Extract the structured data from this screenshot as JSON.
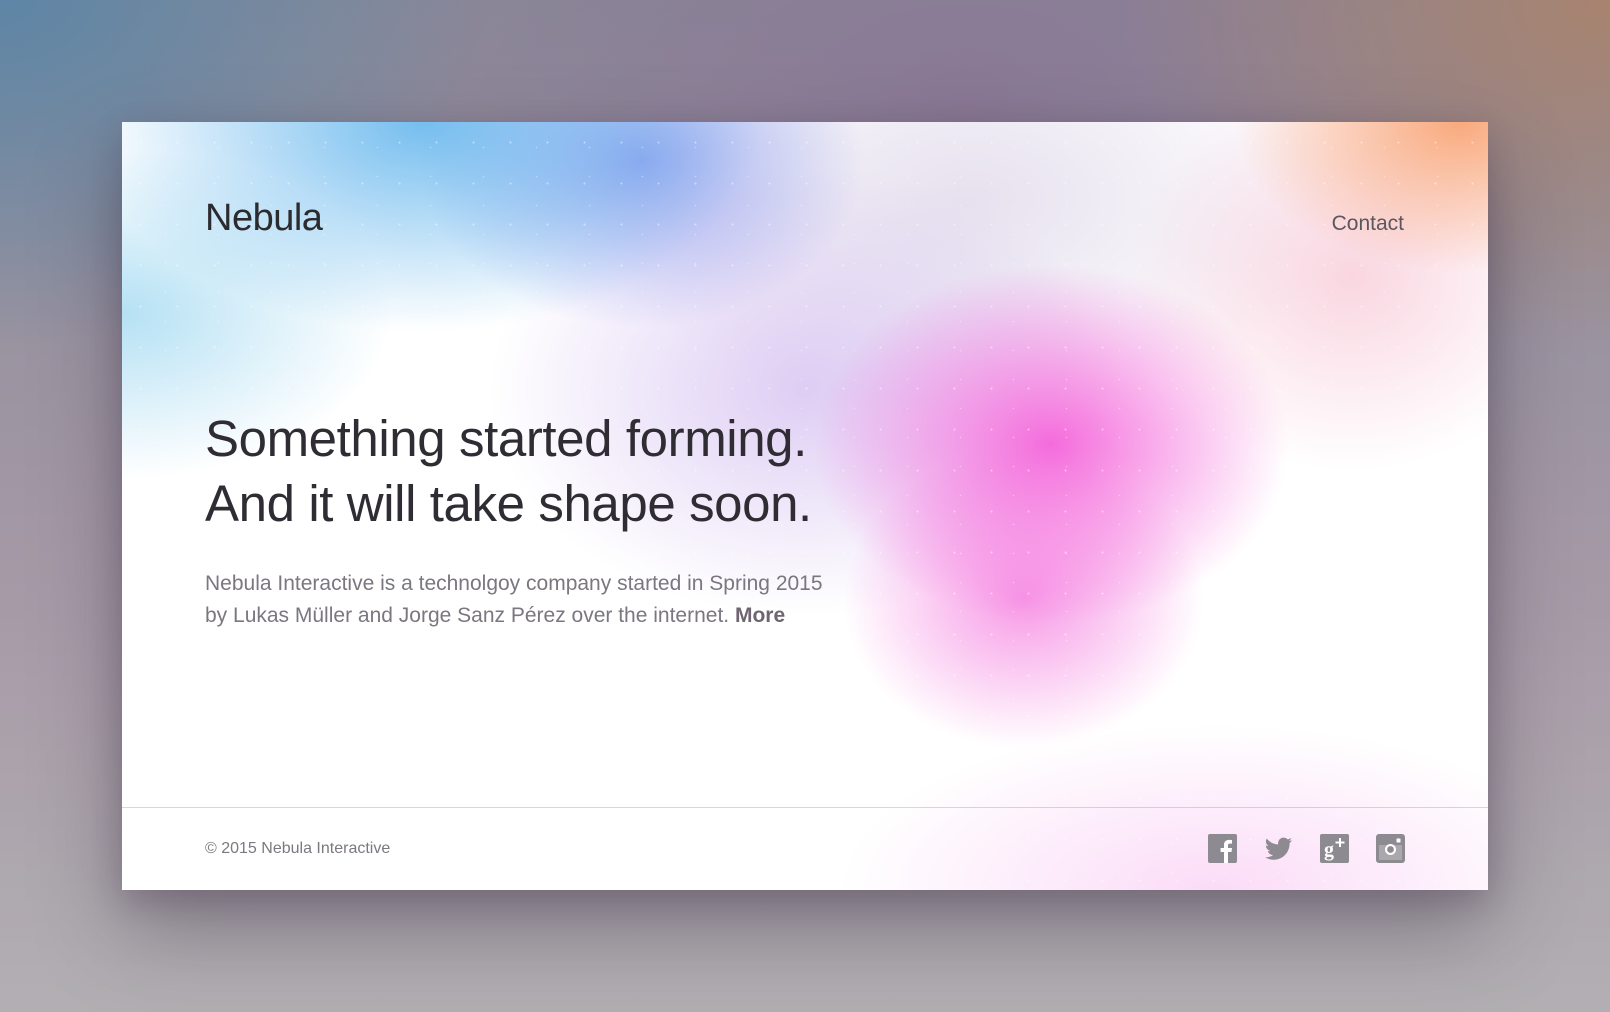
{
  "site": {
    "logo": "Nebula",
    "nav": {
      "contact_label": "Contact"
    }
  },
  "hero": {
    "headline_line1": "Something started forming.",
    "headline_line2": "And it will take shape soon.",
    "description_line1": "Nebula Interactive is a technolgoy company started in Spring 2015",
    "description_line2": "by Lukas Müller and Jorge Sanz Pérez over the internet.",
    "more_label": "More"
  },
  "footer": {
    "copyright": "© 2015 Nebula Interactive",
    "social_icons": [
      "facebook-icon",
      "twitter-icon",
      "google-plus-icon",
      "instagram-icon"
    ]
  },
  "colors": {
    "text_dark": "#2f2d33",
    "text_muted": "#7b7680",
    "icon_gray": "#8e8a92",
    "accent_pink": "#f464da",
    "accent_blue": "#5db2ec",
    "accent_orange": "#f8a06e"
  }
}
